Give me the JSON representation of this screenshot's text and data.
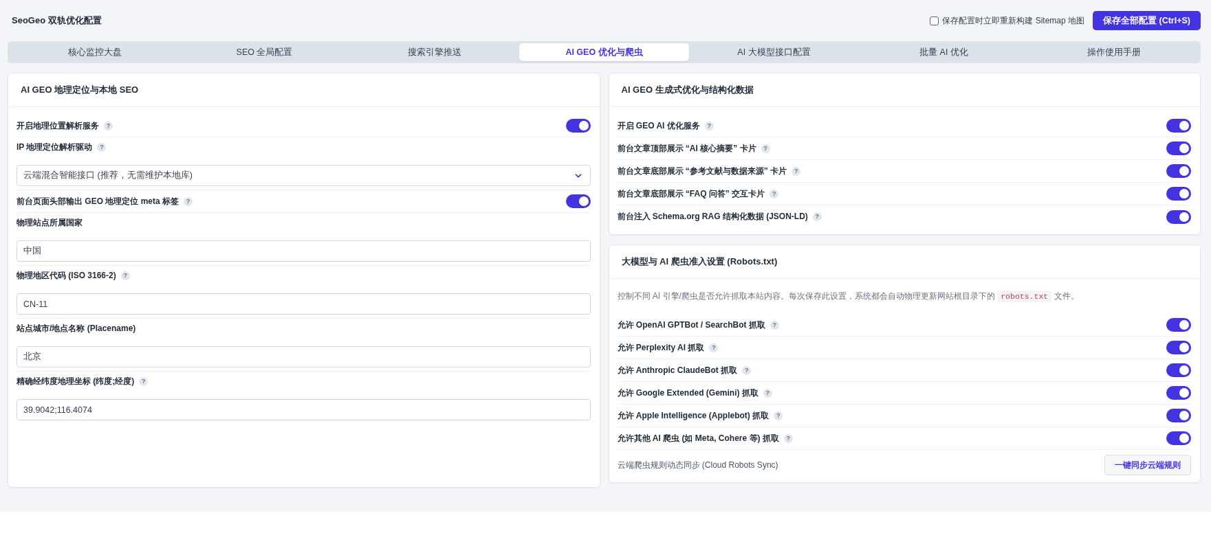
{
  "header": {
    "title": "SeoGeo 双轨优化配置",
    "rebuild_sitemap": {
      "label": "保存配置时立即重新构建 Sitemap 地图",
      "checked": false
    },
    "save_button": "保存全部配置 (Ctrl+S)"
  },
  "tabs": [
    {
      "label": "核心监控大盘",
      "selected": false
    },
    {
      "label": "SEO 全局配置",
      "selected": false
    },
    {
      "label": "搜索引擎推送",
      "selected": false
    },
    {
      "label": "AI GEO 优化与爬虫",
      "selected": true
    },
    {
      "label": "AI 大模型接口配置",
      "selected": false
    },
    {
      "label": "批量 AI 优化",
      "selected": false
    },
    {
      "label": "操作使用手册",
      "selected": false
    }
  ],
  "geo_location_panel": {
    "title": "AI GEO 地理定位与本地 SEO",
    "items": [
      {
        "kind": "toggle",
        "label": "开启地理位置解析服务",
        "help": "?",
        "on": true
      },
      {
        "kind": "select",
        "label": "IP 地理定位解析驱动",
        "help": "?",
        "value": "云端混合智能接口 (推荐，无需维护本地库)"
      },
      {
        "kind": "toggle",
        "label": "前台页面头部输出 GEO 地理定位 meta 标签",
        "help": "?",
        "on": true
      },
      {
        "kind": "input",
        "label": "物理站点所属国家",
        "value": "中国"
      },
      {
        "kind": "input",
        "label": "物理地区代码 (ISO 3166-2)",
        "help": "?",
        "value": "CN-11"
      },
      {
        "kind": "input",
        "label": "站点城市/地点名称 (Placename)",
        "value": "北京"
      },
      {
        "kind": "input",
        "label": "精确经纬度地理坐标 (纬度;经度)",
        "help": "?",
        "value": "39.9042;116.4074"
      }
    ]
  },
  "geo_ai_panel": {
    "title": "AI GEO 生成式优化与结构化数据",
    "items": [
      {
        "label": "开启 GEO AI 优化服务",
        "help": "?",
        "on": true
      },
      {
        "label": "前台文章顶部展示 “AI 核心摘要” 卡片",
        "help": "?",
        "on": true
      },
      {
        "label": "前台文章底部展示 “参考文献与数据来源” 卡片",
        "help": "?",
        "on": true
      },
      {
        "label": "前台文章底部展示 “FAQ 问答” 交互卡片",
        "help": "?",
        "on": true
      },
      {
        "label": "前台注入 Schema.org RAG 结构化数据 (JSON-LD)",
        "help": "?",
        "on": true
      }
    ]
  },
  "crawler_panel": {
    "title": "大模型与 AI 爬虫准入设置 (Robots.txt)",
    "description": {
      "before": "控制不同 AI 引擎/爬虫是否允许抓取本站内容。每次保存此设置，系统都会自动物理更新网站根目录下的 ",
      "code": "robots.txt",
      "after": " 文件。"
    },
    "items": [
      {
        "label": "允许 OpenAI GPTBot / SearchBot 抓取",
        "help": "?",
        "on": true
      },
      {
        "label": "允许 Perplexity AI 抓取",
        "help": "?",
        "on": true
      },
      {
        "label": "允许 Anthropic ClaudeBot 抓取",
        "help": "?",
        "on": true
      },
      {
        "label": "允许 Google Extended (Gemini) 抓取",
        "help": "?",
        "on": true
      },
      {
        "label": "允许 Apple Intelligence (Applebot) 抓取",
        "help": "?",
        "on": true
      },
      {
        "label": "允许其他 AI 爬虫 (如 Meta, Cohere 等) 抓取",
        "help": "?",
        "on": true
      }
    ],
    "sync": {
      "label": "云端爬虫规则动态同步 (Cloud Robots Sync)",
      "button": "一键同步云端规则"
    }
  }
}
